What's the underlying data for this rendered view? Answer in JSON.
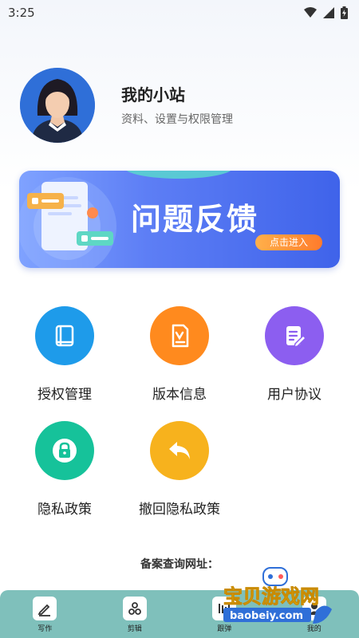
{
  "status_bar": {
    "time": "3:25"
  },
  "profile": {
    "title": "我的小站",
    "subtitle": "资料、设置与权限管理"
  },
  "banner": {
    "title": "问题反馈",
    "button_label": "点击进入"
  },
  "menu": [
    {
      "label": "授权管理",
      "icon": "book-icon",
      "color": "#1e9bea"
    },
    {
      "label": "版本信息",
      "icon": "document-check-icon",
      "color": "#ff8a1e"
    },
    {
      "label": "用户协议",
      "icon": "edit-document-icon",
      "color": "#8c5ef0"
    },
    {
      "label": "隐私政策",
      "icon": "lock-icon",
      "color": "#16c29a"
    },
    {
      "label": "撤回隐私政策",
      "icon": "undo-icon",
      "color": "#f7b21d"
    }
  ],
  "footer": {
    "record_label": "备案查询网址："
  },
  "tabbar": {
    "tabs": [
      {
        "label": "写作",
        "icon": "pen-icon"
      },
      {
        "label": "剪辑",
        "icon": "scissors-icon"
      },
      {
        "label": "跟弹",
        "icon": "music-icon"
      },
      {
        "label": "我的",
        "icon": "user-icon"
      }
    ]
  },
  "watermark": {
    "text": "宝贝游戏网",
    "url": "baobeiy.com"
  }
}
